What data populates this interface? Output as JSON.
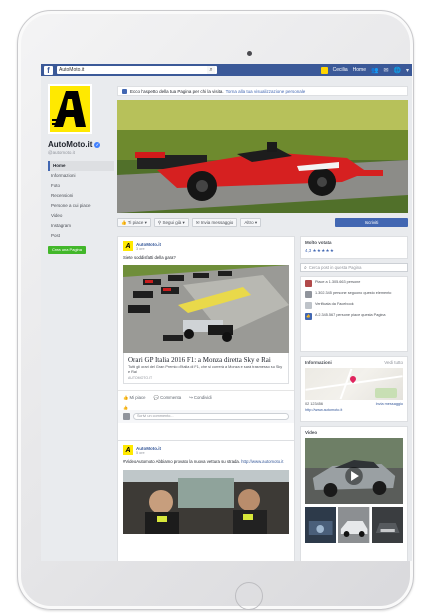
{
  "topbar": {
    "search_value": "AutoMoto.it",
    "user_name": "Cecilia",
    "home_label": "Home"
  },
  "page": {
    "name": "AutoMoto.it",
    "handle": "@automoto.it",
    "logo_letter": "A"
  },
  "left_nav": {
    "items": [
      "Home",
      "Informazioni",
      "Foto",
      "Recensioni",
      "Persone a cui piace",
      "Video",
      "Instagram",
      "Post"
    ],
    "create_page_label": "Crea una Pagina"
  },
  "notice": {
    "text": "Ecco l'aspetto della tua Pagina per chi la visita.",
    "link": "Torna alla tua visualizzazione personale"
  },
  "actions": {
    "liked_label": "Ti piace",
    "following_label": "Segui già",
    "message_label": "Invia messaggio",
    "more_label": "Altro",
    "primary_label": "Iscriviti"
  },
  "post1": {
    "author": "AutoMoto.it",
    "time": "3 ore",
    "text": "Siete soddisfatti della gara?",
    "preview_title": "Orari GP Italia 2016 F1: a Monza diretta Sky e Rai",
    "preview_desc": "Tutti gli orari del Gran Premio d'Italia di F1, che si correrà a Monza e sarà trasmesso su Sky e Rai",
    "preview_domain": "AUTOMOTO.IT",
    "like_label": "Mi piace",
    "comment_label": "Commenta",
    "share_label": "Condividi",
    "comment_placeholder": "Scrivi un commento..."
  },
  "post2": {
    "author": "AutoMoto.it",
    "time": "5 ore",
    "text": "#VideoAutomoto Abbiamo provato la nuova vettura su strada.",
    "link": "http://www.automoto.it"
  },
  "right": {
    "ratings_title": "Molto votata",
    "ratings_value": "4,3",
    "stars": "★★★★★",
    "search_placeholder": "Cerca post in questa Pagina",
    "about_lines": [
      "Piace a 1.305.663 persone",
      "1.302.345 persone seguono questo elemento",
      "Verificata da Facebook",
      "A 2.345.567 persone piace questa Pagina"
    ],
    "map_title": "Informazioni",
    "map_see_all": "Vedi tutto",
    "map_phone": "02 123456",
    "map_link": "Invia messaggio",
    "map_website": "http://www.automoto.it",
    "videos_title": "Video"
  }
}
